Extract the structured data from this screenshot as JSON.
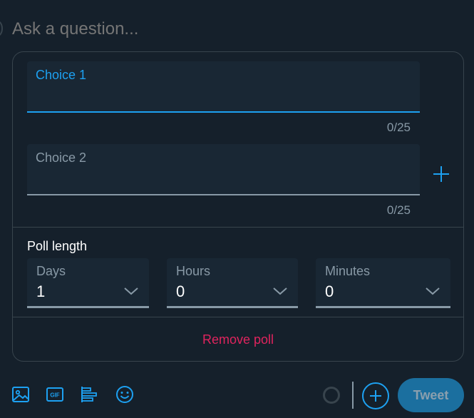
{
  "composer": {
    "question_placeholder": "Ask a question..."
  },
  "poll": {
    "choices": [
      {
        "label": "Choice 1",
        "value": "",
        "counter": "0/25"
      },
      {
        "label": "Choice 2",
        "value": "",
        "counter": "0/25"
      }
    ],
    "length": {
      "title": "Poll length",
      "days": {
        "label": "Days",
        "value": "1"
      },
      "hours": {
        "label": "Hours",
        "value": "0"
      },
      "minutes": {
        "label": "Minutes",
        "value": "0"
      }
    },
    "remove_label": "Remove poll"
  },
  "toolbar": {
    "tweet_label": "Tweet",
    "icons": [
      "image-icon",
      "gif-icon",
      "poll-icon",
      "emoji-icon"
    ]
  },
  "colors": {
    "background": "#15202b",
    "accent": "#1da1f2",
    "danger": "#e0245e",
    "border": "#38444d",
    "muted": "#8899a6"
  }
}
